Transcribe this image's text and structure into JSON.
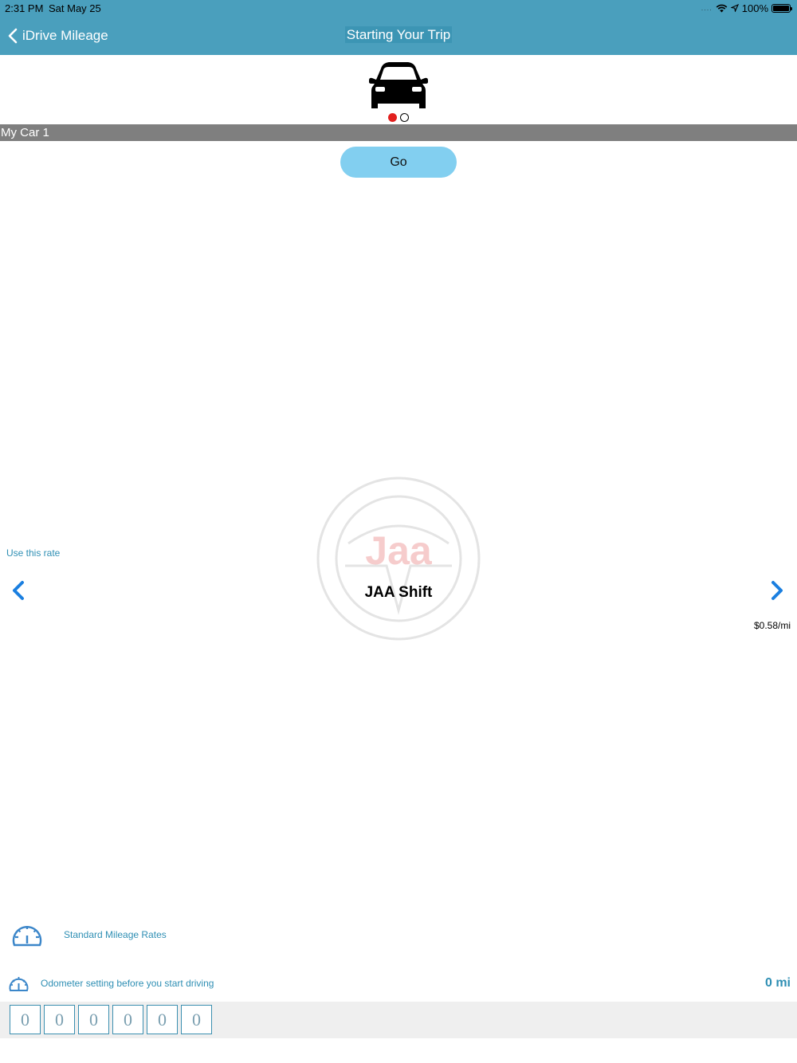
{
  "status_bar": {
    "time": "2:31 PM",
    "date": "Sat May 25",
    "signal": "....",
    "battery_pct": "100%"
  },
  "nav": {
    "back_label": "iDrive Mileage",
    "title": "Starting Your Trip"
  },
  "car_selector": {
    "car_name": "My Car 1",
    "page_count": 2,
    "active_page": 1,
    "icon": "car-icon"
  },
  "go_button": {
    "label": "Go"
  },
  "rate": {
    "use_label": "Use this rate",
    "name": "JAA Shift",
    "value": "$0.58/mi",
    "logo_text": "Jaa"
  },
  "bottom": {
    "standard_rates_label": "Standard Mileage Rates",
    "odometer_label": "Odometer setting before you start driving",
    "odometer_total": "0 mi",
    "digits": [
      "0",
      "0",
      "0",
      "0",
      "0",
      "0"
    ]
  },
  "colors": {
    "navbar": "#4a9fbd",
    "accent_text": "#2f8fb4",
    "go_button": "#82cff0",
    "active_dot": "#e2201f",
    "arrow": "#1b7fe0"
  }
}
